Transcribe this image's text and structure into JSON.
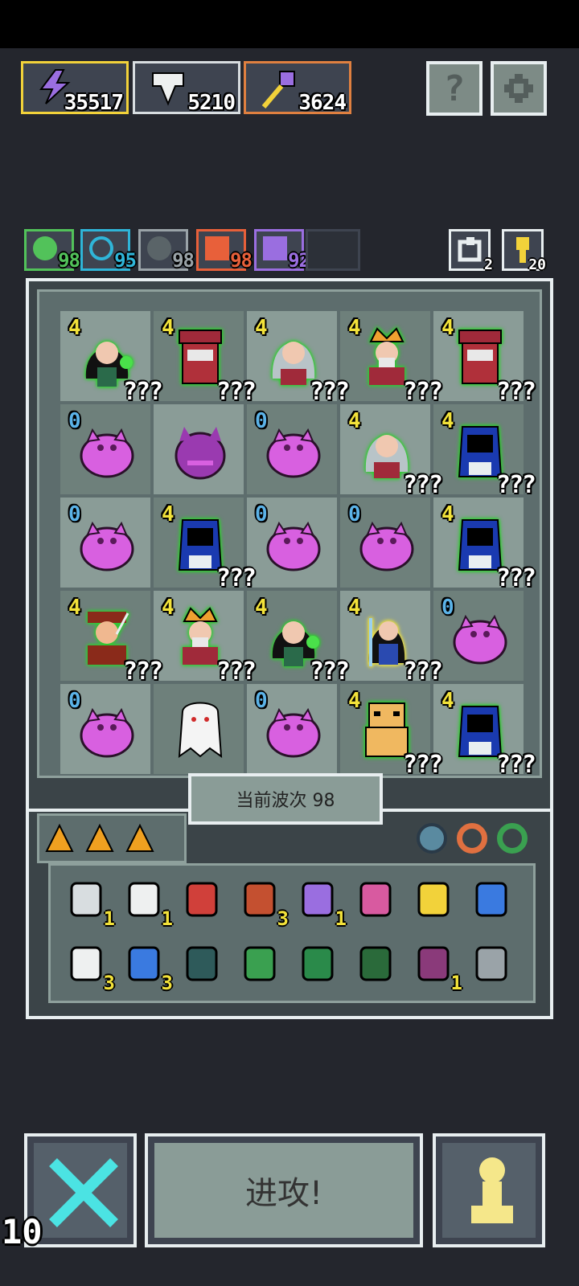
{
  "currencies": [
    {
      "name": "energy",
      "value": "35517",
      "border": "#f2d23a",
      "icon": "lightning-icon"
    },
    {
      "name": "souls",
      "value": "5210",
      "border": "#d8dde0",
      "icon": "soul-icon"
    },
    {
      "name": "keys",
      "value": "3624",
      "border": "#e08040",
      "icon": "key-icon"
    }
  ],
  "top_buttons": {
    "help_label": "?",
    "settings_icon": "gear-icon"
  },
  "stats": [
    {
      "value": "98",
      "color": "#52c25a",
      "icon": "green-stat-icon"
    },
    {
      "value": "95",
      "color": "#2fb5d8",
      "icon": "swirl-stat-icon"
    },
    {
      "value": "98",
      "color": "#9aa3a8",
      "icon": "x-stat-icon"
    },
    {
      "value": "98",
      "color": "#e8603a",
      "icon": "plus-stat-icon"
    },
    {
      "value": "92",
      "color": "#9a6ee0",
      "icon": "bolt-stat-icon"
    }
  ],
  "small_counters": [
    {
      "value": "2",
      "icon": "reroll-icon"
    },
    {
      "value": "20",
      "icon": "key-icon"
    }
  ],
  "board": {
    "rows": [
      [
        {
          "level": "4",
          "level_color": "y",
          "unit": "witch",
          "tag": "???",
          "outline": "#2ad02a"
        },
        {
          "level": "4",
          "level_color": "y",
          "unit": "bandit",
          "tag": "???",
          "outline": "#2ad02a"
        },
        {
          "level": "4",
          "level_color": "y",
          "unit": "elder",
          "tag": "???",
          "outline": "#2ad02a"
        },
        {
          "level": "4",
          "level_color": "y",
          "unit": "king",
          "tag": "???",
          "outline": "#2ad02a"
        },
        {
          "level": "4",
          "level_color": "y",
          "unit": "bandit",
          "tag": "???",
          "outline": "#2ad02a"
        }
      ],
      [
        {
          "level": "0",
          "level_color": "b",
          "unit": "demon",
          "tag": "",
          "outline": ""
        },
        {
          "level": "",
          "level_color": "b",
          "unit": "demon-dark",
          "tag": "",
          "outline": ""
        },
        {
          "level": "0",
          "level_color": "b",
          "unit": "demon",
          "tag": "",
          "outline": ""
        },
        {
          "level": "4",
          "level_color": "y",
          "unit": "elder",
          "tag": "???",
          "outline": "#2ad02a"
        },
        {
          "level": "4",
          "level_color": "y",
          "unit": "hood",
          "tag": "???",
          "outline": "#2ad02a"
        }
      ],
      [
        {
          "level": "0",
          "level_color": "b",
          "unit": "demon",
          "tag": "",
          "outline": ""
        },
        {
          "level": "4",
          "level_color": "y",
          "unit": "hood",
          "tag": "???",
          "outline": "#2ad02a"
        },
        {
          "level": "0",
          "level_color": "b",
          "unit": "demon",
          "tag": "",
          "outline": ""
        },
        {
          "level": "0",
          "level_color": "b",
          "unit": "demon",
          "tag": "",
          "outline": ""
        },
        {
          "level": "4",
          "level_color": "y",
          "unit": "hood",
          "tag": "???",
          "outline": "#2ad02a"
        }
      ],
      [
        {
          "level": "4",
          "level_color": "y",
          "unit": "archer",
          "tag": "???",
          "outline": "#2ad02a"
        },
        {
          "level": "4",
          "level_color": "y",
          "unit": "king",
          "tag": "???",
          "outline": "#2ad02a"
        },
        {
          "level": "4",
          "level_color": "y",
          "unit": "witch",
          "tag": "???",
          "outline": "#2ad02a"
        },
        {
          "level": "4",
          "level_color": "y",
          "unit": "mage",
          "tag": "???",
          "outline": "#f2e23a"
        },
        {
          "level": "0",
          "level_color": "b",
          "unit": "demon",
          "tag": "",
          "outline": ""
        }
      ],
      [
        {
          "level": "0",
          "level_color": "b",
          "unit": "demon",
          "tag": "",
          "outline": ""
        },
        {
          "level": "",
          "level_color": "b",
          "unit": "ghost",
          "tag": "",
          "outline": ""
        },
        {
          "level": "0",
          "level_color": "b",
          "unit": "demon",
          "tag": "",
          "outline": ""
        },
        {
          "level": "4",
          "level_color": "y",
          "unit": "golem",
          "tag": "???",
          "outline": "#2ad02a"
        },
        {
          "level": "4",
          "level_color": "y",
          "unit": "hood",
          "tag": "???",
          "outline": "#2ad02a"
        }
      ]
    ]
  },
  "wave_label": "当前波次 98",
  "inventory": {
    "items": [
      {
        "icon": "scroll-icon",
        "count": "1",
        "color": "#d8dde0"
      },
      {
        "icon": "bone-icon",
        "count": "1",
        "color": "#eef0f0"
      },
      {
        "icon": "crab-icon",
        "count": "",
        "color": "#d0403a"
      },
      {
        "icon": "spiked-helmet-icon",
        "count": "3",
        "color": "#c45030"
      },
      {
        "icon": "potion-jar-icon",
        "count": "1",
        "color": "#9a6ee0"
      },
      {
        "icon": "arrow-icon",
        "count": "",
        "color": "#d85aa0"
      },
      {
        "icon": "golden-key-icon",
        "count": "",
        "color": "#f2d23a"
      },
      {
        "icon": "blue-claw-icon",
        "count": "",
        "color": "#3a7ae0"
      },
      {
        "icon": "white-claw-icon",
        "count": "3",
        "color": "#eef0f0"
      },
      {
        "icon": "hourglass-icon",
        "count": "3",
        "color": "#3a7ae0"
      },
      {
        "icon": "bell-icon",
        "count": "",
        "color": "#2e5a5a"
      },
      {
        "icon": "green-arrow-icon",
        "count": "",
        "color": "#3aa050"
      },
      {
        "icon": "green-tome-icon",
        "count": "",
        "color": "#2a8a4a"
      },
      {
        "icon": "rose-tome-icon",
        "count": "",
        "color": "#2a6a3a"
      },
      {
        "icon": "demon-orb-icon",
        "count": "1",
        "color": "#8a3a7a"
      },
      {
        "icon": "lever-icon",
        "count": "",
        "color": "#9aa3a8"
      }
    ],
    "equip": [
      {
        "icon": "beetle-icon",
        "color": "#5a8aa0"
      },
      {
        "icon": "orange-ring-icon",
        "color": "#e07040"
      },
      {
        "icon": "green-ring-icon",
        "color": "#3aa050"
      }
    ]
  },
  "bottom": {
    "cancel_icon": "crossed-swords-icon",
    "attack_label": "进攻!",
    "player_icon": "pawn-icon",
    "counter": "10"
  }
}
